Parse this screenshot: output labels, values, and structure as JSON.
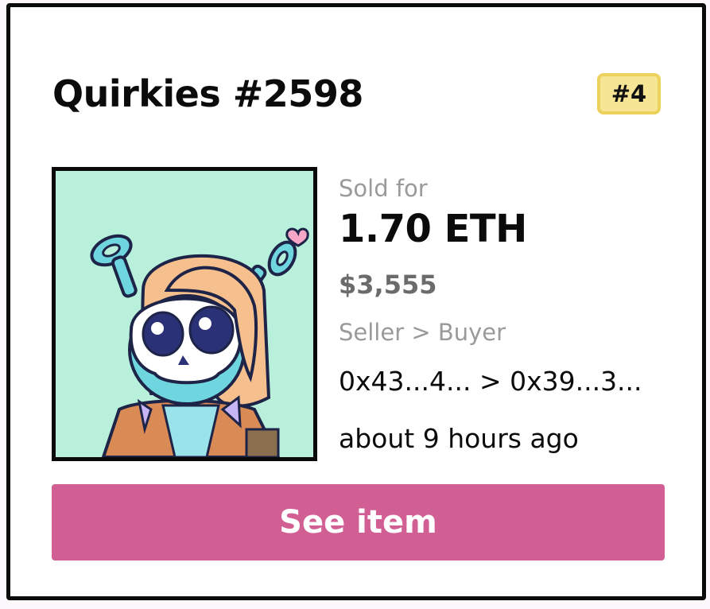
{
  "card": {
    "title": "Quirkies #2598",
    "rank_badge": "#4",
    "image_alt_icon": "nft-artwork",
    "sold_label": "Sold for",
    "price_eth": "1.70 ETH",
    "price_usd": "$3,555",
    "seller_buyer_label": "Seller > Buyer",
    "addresses": "0x43...4... > 0x39...3...",
    "time_ago": "about 9 hours ago",
    "see_item_label": "See item"
  },
  "colors": {
    "button": "#d15f93",
    "badge_bg": "#f7e596",
    "badge_border": "#ecd25c",
    "art_bg": "#b8f0dc"
  }
}
